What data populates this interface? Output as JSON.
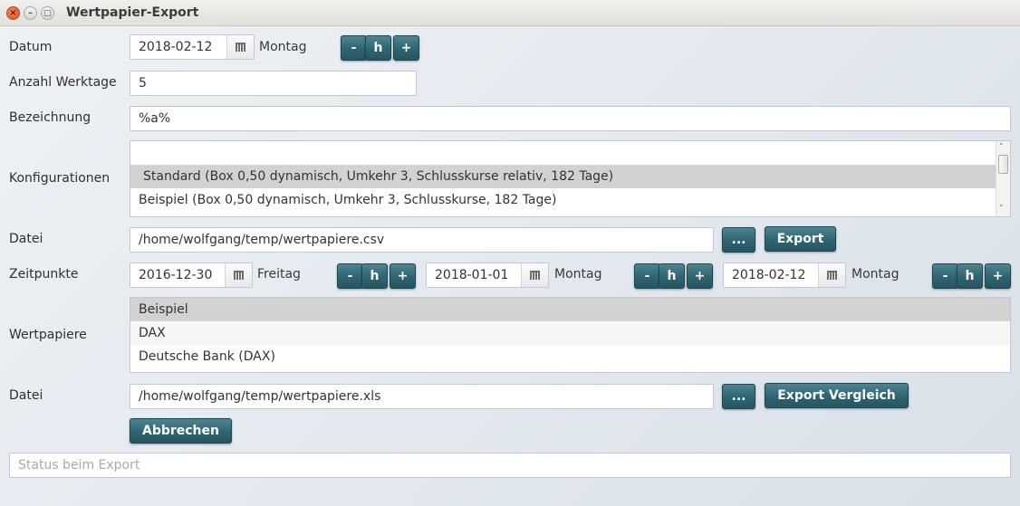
{
  "window": {
    "title": "Wertpapier-Export",
    "close_glyph": "×",
    "minimize_glyph": "–",
    "maximize_glyph": "□"
  },
  "datum": {
    "label": "Datum",
    "value": "2018-02-12",
    "weekday": "Montag",
    "btn_minus": "-",
    "btn_h": "h",
    "btn_plus": "+"
  },
  "werktage": {
    "label": "Anzahl Werktage",
    "value": "5"
  },
  "bezeichnung": {
    "label": "Bezeichnung",
    "value": "%a%"
  },
  "konfigurationen": {
    "label": "Konfigurationen",
    "items": [
      "",
      "Standard (Box 0,50 dynamisch, Umkehr 3, Schlusskurse relativ, 182 Tage)",
      "Beispiel (Box 0,50 dynamisch, Umkehr 3, Schlusskurse, 182 Tage)"
    ],
    "selected_index": 1,
    "scroll_up": "˄",
    "scroll_down": "˅"
  },
  "datei1": {
    "label": "Datei",
    "value": "/home/wolfgang/temp/wertpapiere.csv",
    "browse_label": "...",
    "export_label": "Export"
  },
  "zeitpunkte": {
    "label": "Zeitpunkte",
    "dates": [
      {
        "value": "2016-12-30",
        "weekday": "Freitag"
      },
      {
        "value": "2018-01-01",
        "weekday": "Montag"
      },
      {
        "value": "2018-02-12",
        "weekday": "Montag"
      }
    ],
    "btn_minus": "-",
    "btn_h": "h",
    "btn_plus": "+"
  },
  "wertpapiere": {
    "label": "Wertpapiere",
    "items": [
      "Beispiel",
      "DAX",
      "Deutsche Bank (DAX)"
    ],
    "selected_index": 0
  },
  "datei2": {
    "label": "Datei",
    "value": "/home/wolfgang/temp/wertpapiere.xls",
    "browse_label": "...",
    "export_label": "Export Vergleich"
  },
  "abbrechen_label": "Abbrechen",
  "status": {
    "placeholder": "Status beim Export"
  }
}
